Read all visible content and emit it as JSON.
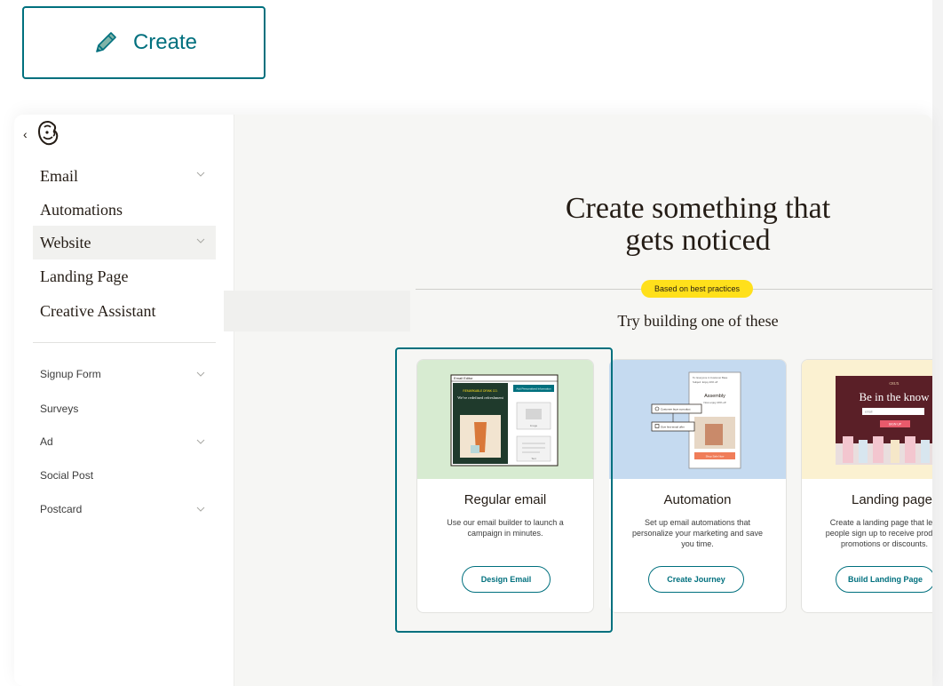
{
  "create_button": {
    "label": "Create",
    "icon": "pencil-icon"
  },
  "sidebar": {
    "collapse_glyph": "‹",
    "logo": "mailchimp-freddie-logo",
    "primary_items": [
      {
        "label": "Email",
        "has_chevron": true
      },
      {
        "label": "Automations",
        "has_chevron": false
      },
      {
        "label": "Website",
        "has_chevron": true,
        "active": true
      },
      {
        "label": "Landing Page",
        "has_chevron": false
      },
      {
        "label": "Creative Assistant",
        "has_chevron": false
      }
    ],
    "secondary_items": [
      {
        "label": "Signup Form",
        "has_chevron": true
      },
      {
        "label": "Surveys",
        "has_chevron": false
      },
      {
        "label": "Ad",
        "has_chevron": true
      },
      {
        "label": "Social Post",
        "has_chevron": false
      },
      {
        "label": "Postcard",
        "has_chevron": true
      }
    ]
  },
  "main": {
    "headline_line1": "Create something that",
    "headline_line2": "gets noticed",
    "badge": "Based on best practices",
    "subheading": "Try building one of these",
    "cards": [
      {
        "title": "Regular email",
        "description": "Use our email builder to launch a campaign in minutes.",
        "button": "Design Email",
        "thumb": {
          "editor_title": "Email Editor",
          "brand": "REMARKABLE DRINK CO.",
          "headline": "We've redefined refreshment",
          "tag": "Add Personalized Information",
          "image_label": "Image",
          "text_label": "Text"
        }
      },
      {
        "title": "Automation",
        "description": "Set up email automations that personalize your marketing and save you time.",
        "button": "Create Journey",
        "thumb": {
          "to_line": "To: Everyone in Customer Base",
          "subject": "Subject: Enjoy 20% off",
          "brand": "Assembly",
          "promo": "Now enjoy 20% off",
          "step1": "Customer buys a product",
          "step2": "Give first-email offer",
          "cta": "Shop Sale Now"
        }
      },
      {
        "title": "Landing page",
        "description": "Create a landing page that lets people sign up to receive product promotions or discounts.",
        "button": "Build Landing Page",
        "thumb": {
          "brand": "CRUX",
          "headline": "Be in the know",
          "email_placeholder": "email",
          "signup": "SIGN UP"
        }
      }
    ]
  },
  "colors": {
    "teal": "#00707e",
    "yellow": "#ffe01b",
    "green_bg": "#d7ebd1",
    "blue_bg": "#c5daf0",
    "cream_bg": "#fbf1d1"
  }
}
